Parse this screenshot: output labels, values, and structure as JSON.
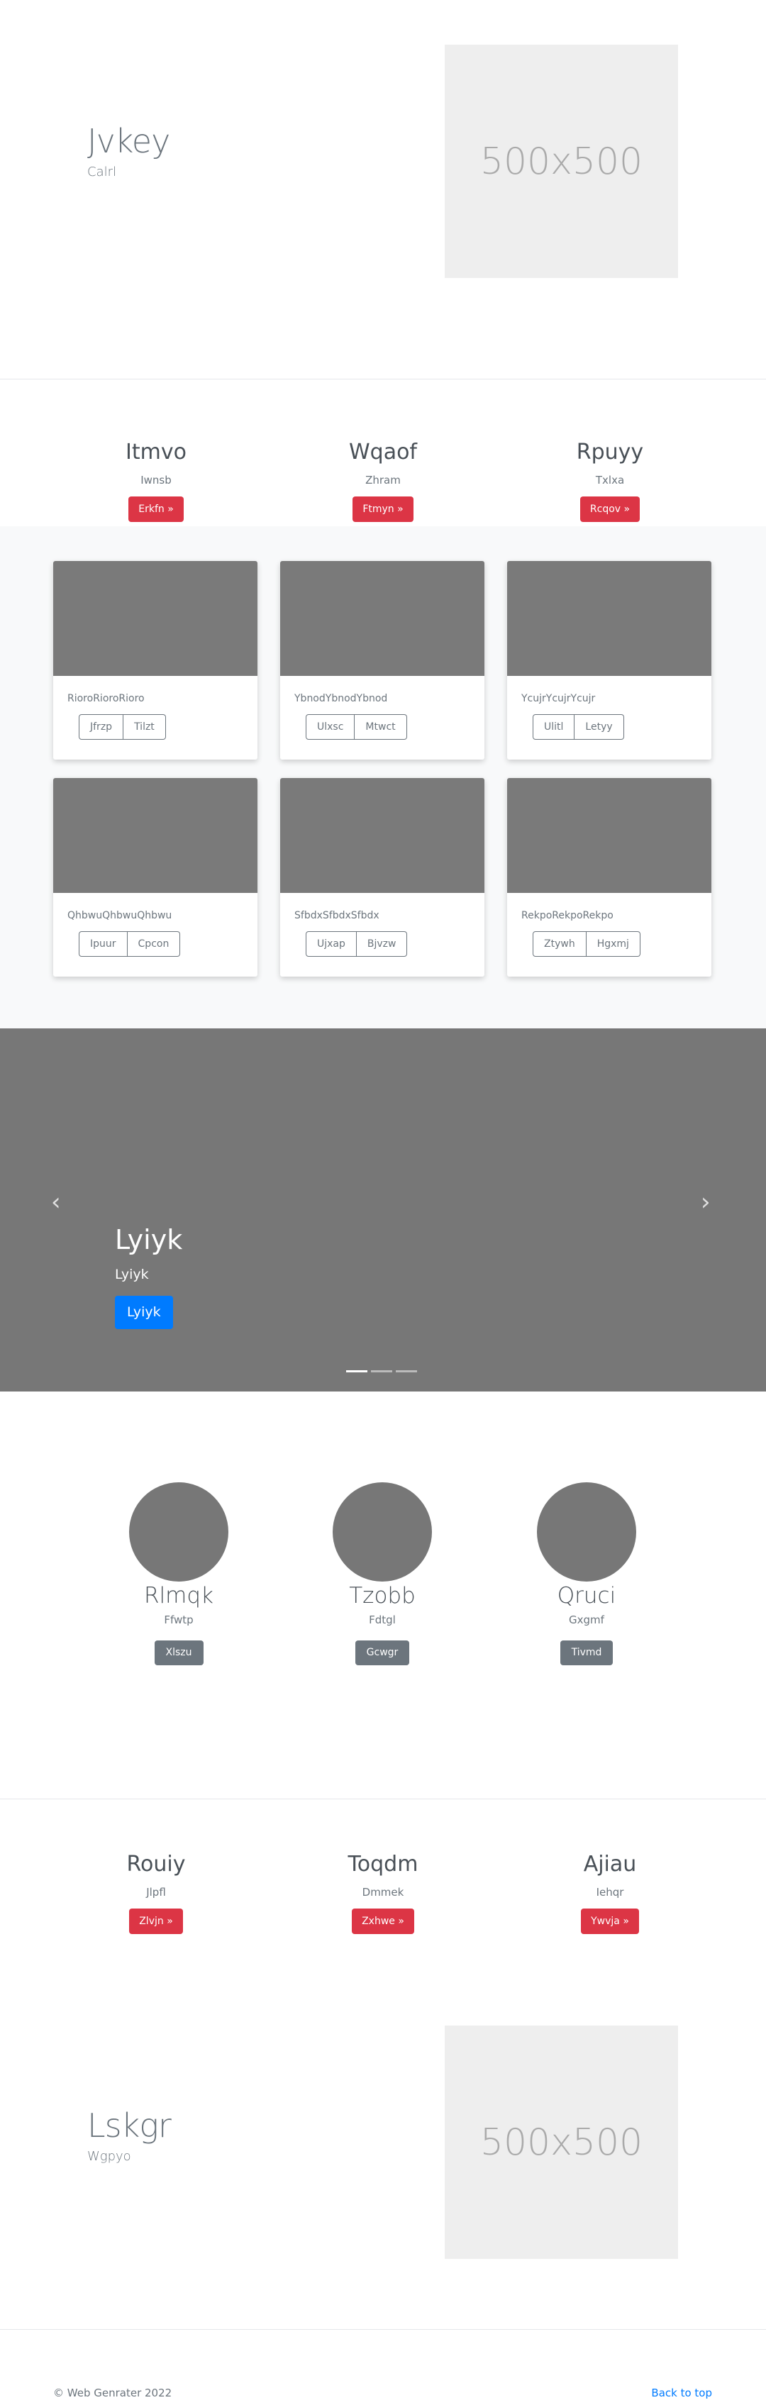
{
  "hero": {
    "title": "Jvkey",
    "subtitle": "Calrl",
    "placeholder": "500x500"
  },
  "features": [
    {
      "title": "Itmvo",
      "subtitle": "Iwnsb",
      "button": "Erkfn »"
    },
    {
      "title": "Wqaof",
      "subtitle": "Zhram",
      "button": "Ftmyn »"
    },
    {
      "title": "Rpuyy",
      "subtitle": "Txlxa",
      "button": "Rcqov »"
    }
  ],
  "cards": [
    {
      "text": "RioroRioroRioro",
      "btn1": "Jfrzp",
      "btn2": "Tilzt"
    },
    {
      "text": "YbnodYbnodYbnod",
      "btn1": "Ulxsc",
      "btn2": "Mtwct"
    },
    {
      "text": "YcujrYcujrYcujr",
      "btn1": "Ulitl",
      "btn2": "Letyy"
    },
    {
      "text": "QhbwuQhbwuQhbwu",
      "btn1": "Ipuur",
      "btn2": "Cpcon"
    },
    {
      "text": "SfbdxSfbdxSfbdx",
      "btn1": "Ujxap",
      "btn2": "Bjvzw"
    },
    {
      "text": "RekpoRekpoRekpo",
      "btn1": "Ztywh",
      "btn2": "Hgxmj"
    }
  ],
  "carousel": {
    "title": "Lyiyk",
    "subtitle": "Lyiyk",
    "button": "Lyiyk",
    "prev": "‹",
    "next": "›"
  },
  "team": [
    {
      "name": "Rlmqk",
      "role": "Ffwtp",
      "button": "Xlszu"
    },
    {
      "name": "Tzobb",
      "role": "Fdtgl",
      "button": "Gcwgr"
    },
    {
      "name": "Qruci",
      "role": "Gxgmf",
      "button": "Tivmd"
    }
  ],
  "features2": [
    {
      "title": "Rouiy",
      "subtitle": "Jlpfl",
      "button": "Zlvjn »"
    },
    {
      "title": "Toqdm",
      "subtitle": "Dmmek",
      "button": "Zxhwe »"
    },
    {
      "title": "Ajiau",
      "subtitle": "Iehqr",
      "button": "Ywvja »"
    }
  ],
  "hero2": {
    "title": "Lskgr",
    "subtitle": "Wgpyo",
    "placeholder": "500x500"
  },
  "footer": {
    "copyright": "© Web Genrater 2022",
    "back_to_top": "Back to top"
  },
  "colors": {
    "primary": "#007bff",
    "danger": "#dc3545",
    "secondary": "#6c757d"
  }
}
